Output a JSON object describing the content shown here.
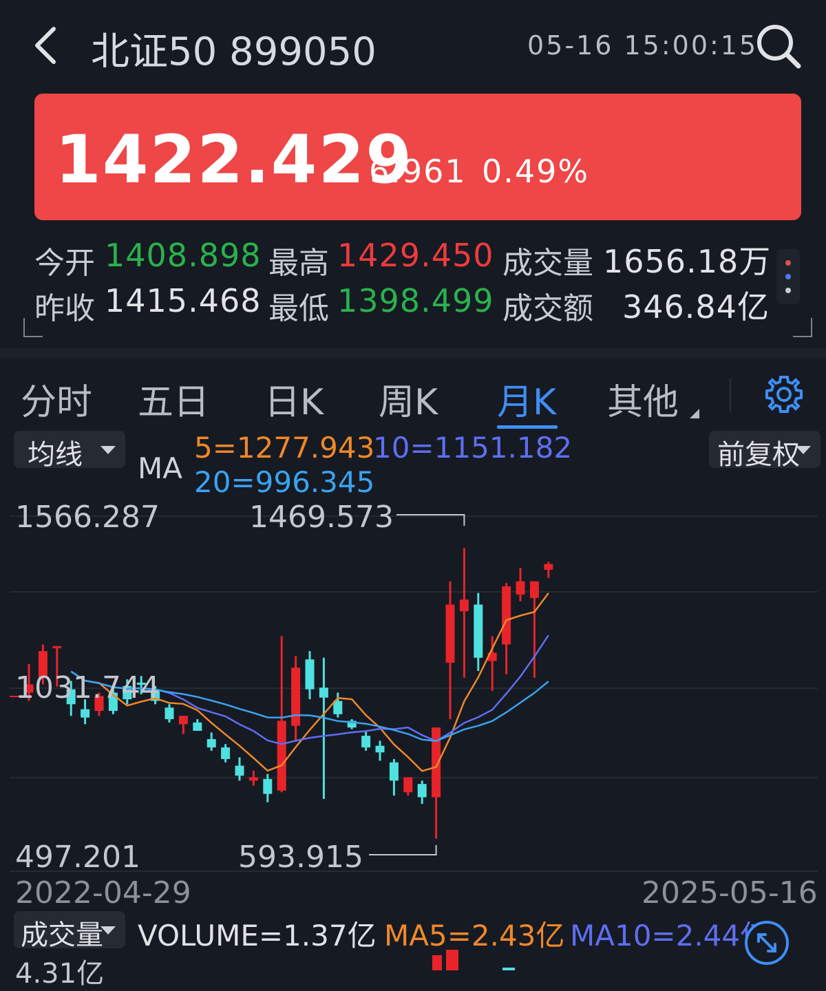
{
  "header": {
    "title": "北证50 899050",
    "datetime": "05-16 15:00:15"
  },
  "quote": {
    "price": "1422.429",
    "change": "6.961",
    "change_pct": "0.49%",
    "banner_color": "#ef4647"
  },
  "stats": {
    "open_label": "今开",
    "open_value": "1408.898",
    "high_label": "最高",
    "high_value": "1429.450",
    "volume_label": "成交量",
    "volume_value": "1656.18万",
    "prev_close_label": "昨收",
    "prev_close_value": "1415.468",
    "low_label": "最低",
    "low_value": "1398.499",
    "amount_label": "成交额",
    "amount_value": "346.84亿"
  },
  "tabs": [
    {
      "label": "分时"
    },
    {
      "label": "五日"
    },
    {
      "label": "日K"
    },
    {
      "label": "周K"
    },
    {
      "label": "月K",
      "active": true
    },
    {
      "label": "其他"
    }
  ],
  "chart": {
    "indicator_dropdown": "均线",
    "ma_label": "MA",
    "ma5": "5=1277.943",
    "ma10": "10=1151.182",
    "ma20": "20=996.345",
    "adjust_dropdown": "前复权",
    "y_top": "1566.287",
    "y_mid": "1031.744",
    "y_bottom": "497.201",
    "high_marker": "1469.573",
    "low_marker": "593.915",
    "start_date": "2022-04-29",
    "end_date": "2025-05-16"
  },
  "chart_data": {
    "type": "candlestick",
    "period": "monthly",
    "y_range": [
      497.201,
      1566.287
    ],
    "x_range": [
      "2022-04-29",
      "2025-05-16"
    ],
    "highest": 1469.573,
    "lowest": 593.915,
    "candles": [
      {
        "open": 1035,
        "high": 1121,
        "low": 1010,
        "close": 1060
      },
      {
        "open": 1080,
        "high": 1180,
        "low": 1060,
        "close": 1160
      },
      {
        "open": 1175,
        "high": 1145,
        "low": 1053,
        "close": 1175
      },
      {
        "open": 1045,
        "high": 1070,
        "low": 965,
        "close": 1000
      },
      {
        "open": 985,
        "high": 1015,
        "low": 940,
        "close": 960
      },
      {
        "open": 980,
        "high": 1035,
        "low": 965,
        "close": 1025
      },
      {
        "open": 1035,
        "high": 1050,
        "low": 970,
        "close": 980
      },
      {
        "open": 1055,
        "high": 1075,
        "low": 1000,
        "close": 1015
      },
      {
        "open": 1065,
        "high": 1085,
        "low": 1030,
        "close": 1060
      },
      {
        "open": 1040,
        "high": 1055,
        "low": 1000,
        "close": 1010
      },
      {
        "open": 990,
        "high": 1000,
        "low": 945,
        "close": 955
      },
      {
        "open": 940,
        "high": 965,
        "low": 910,
        "close": 965
      },
      {
        "open": 945,
        "high": 955,
        "low": 920,
        "close": 920
      },
      {
        "open": 895,
        "high": 915,
        "low": 860,
        "close": 870
      },
      {
        "open": 870,
        "high": 880,
        "low": 825,
        "close": 835
      },
      {
        "open": 815,
        "high": 840,
        "low": 770,
        "close": 785
      },
      {
        "open": 770,
        "high": 800,
        "low": 755,
        "close": 780
      },
      {
        "open": 775,
        "high": 790,
        "low": 705,
        "close": 730
      },
      {
        "open": 740,
        "high": 1205,
        "low": 735,
        "close": 950
      },
      {
        "open": 935,
        "high": 1145,
        "low": 890,
        "close": 1110
      },
      {
        "open": 1135,
        "high": 1160,
        "low": 1015,
        "close": 1045
      },
      {
        "open": 1050,
        "high": 1140,
        "low": 715,
        "close": 1020
      },
      {
        "open": 1010,
        "high": 1035,
        "low": 960,
        "close": 970
      },
      {
        "open": 950,
        "high": 955,
        "low": 925,
        "close": 930
      },
      {
        "open": 905,
        "high": 920,
        "low": 860,
        "close": 870
      },
      {
        "open": 875,
        "high": 890,
        "low": 830,
        "close": 855
      },
      {
        "open": 825,
        "high": 835,
        "low": 725,
        "close": 770
      },
      {
        "open": 735,
        "high": 745,
        "low": 725,
        "close": 780
      },
      {
        "open": 760,
        "high": 770,
        "low": 700,
        "close": 720
      },
      {
        "open": 720,
        "high": 900,
        "low": 595,
        "close": 930
      },
      {
        "open": 1125,
        "high": 1370,
        "low": 955,
        "close": 1300
      },
      {
        "open": 1280,
        "high": 1470,
        "low": 1080,
        "close": 1315
      },
      {
        "open": 1300,
        "high": 1335,
        "low": 1100,
        "close": 1140
      },
      {
        "open": 1130,
        "high": 1205,
        "low": 1040,
        "close": 1155
      },
      {
        "open": 1180,
        "high": 1365,
        "low": 1090,
        "close": 1355
      },
      {
        "open": 1330,
        "high": 1410,
        "low": 1310,
        "close": 1370
      },
      {
        "open": 1320,
        "high": 1360,
        "low": 1080,
        "close": 1370
      },
      {
        "open": 1405,
        "high": 1429,
        "low": 1380,
        "close": 1422
      }
    ],
    "ma_lines": [
      {
        "name": "5",
        "color": "#f0882a"
      },
      {
        "name": "10",
        "color": "#5f6ef0"
      },
      {
        "name": "20",
        "color": "#3aa3f0"
      }
    ],
    "up_color": "#e8242a",
    "down_color": "#4fe0e0"
  },
  "volume": {
    "indicator_dropdown": "成交量",
    "volume_text": "VOLUME=1.37亿",
    "ma5_text": "MA5=2.43亿",
    "ma10_text": "MA10=2.44亿",
    "max_label": "4.31亿"
  }
}
